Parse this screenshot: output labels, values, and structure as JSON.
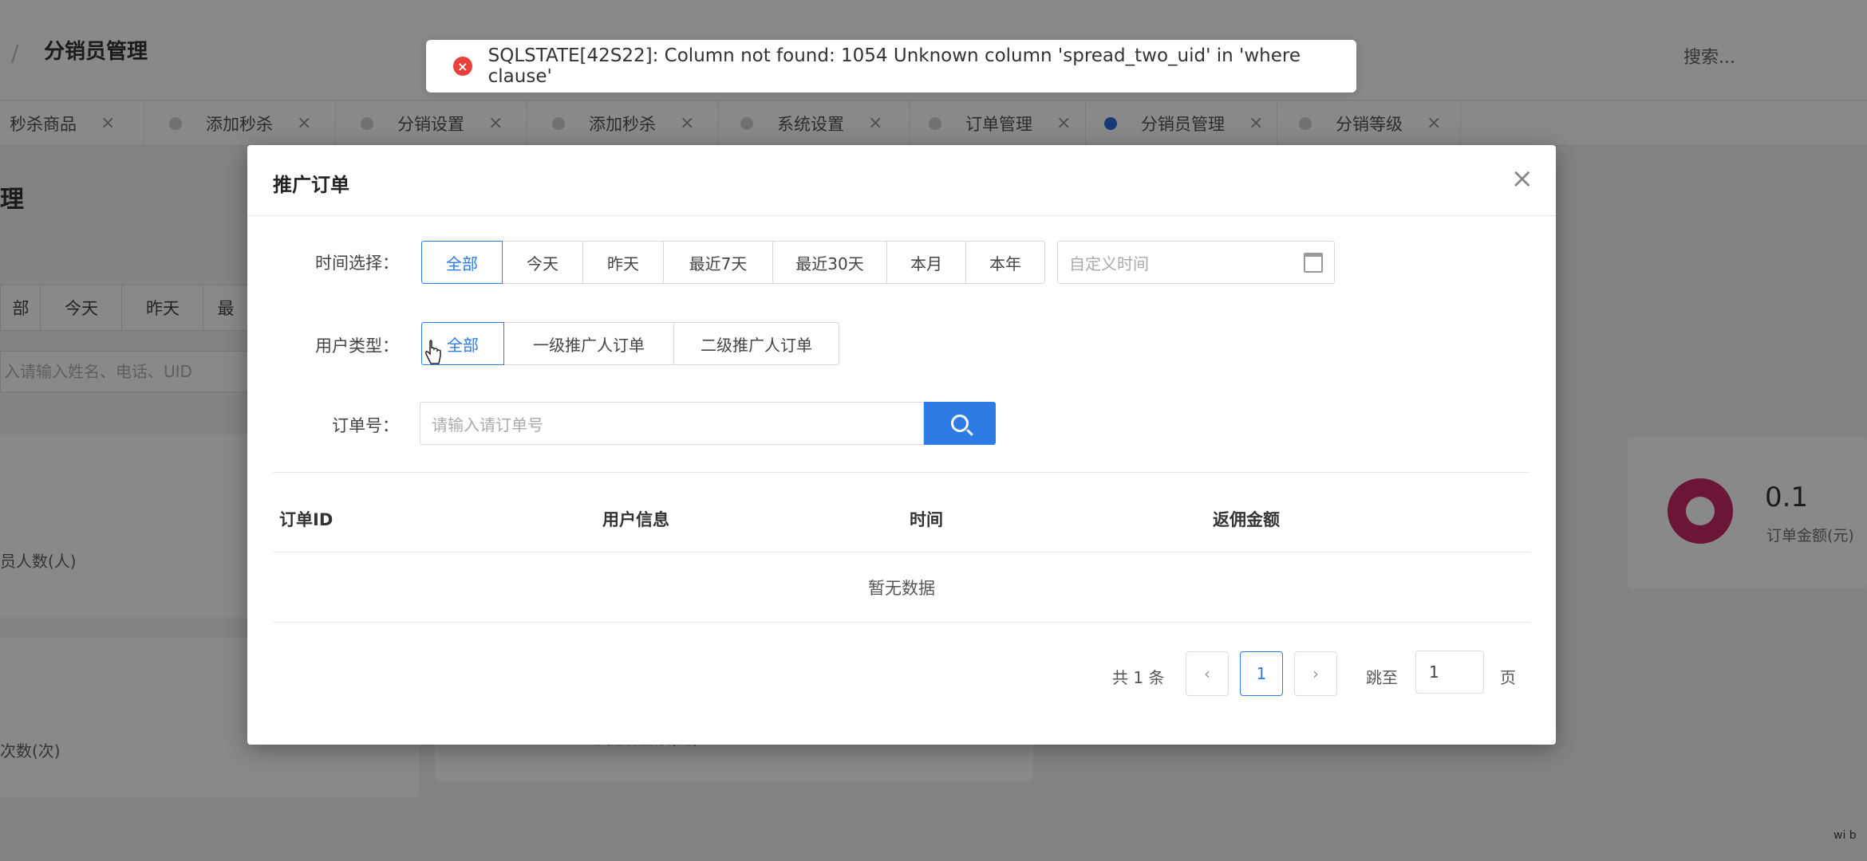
{
  "header": {
    "page_title": "分销员管理",
    "search_label": "搜索..."
  },
  "tabs": [
    {
      "label": "秒杀商品",
      "close": "×",
      "active": false
    },
    {
      "label": "添加秒杀",
      "close": "×",
      "active": false
    },
    {
      "label": "分销设置",
      "close": "×",
      "active": false
    },
    {
      "label": "添加秒杀",
      "close": "×",
      "active": false
    },
    {
      "label": "系统设置",
      "close": "×",
      "active": false
    },
    {
      "label": "订单管理",
      "close": "×",
      "active": false
    },
    {
      "label": "分销员管理",
      "close": "×",
      "active": true
    },
    {
      "label": "分销等级",
      "close": "×",
      "active": false
    }
  ],
  "toast": {
    "type": "error",
    "message": "SQLSTATE[42S22]: Column not found: 1054 Unknown column 'spread_two_uid' in 'where clause'"
  },
  "background": {
    "title_fragment": "理",
    "filters": [
      "部",
      "今天",
      "昨天",
      "最"
    ],
    "search_placeholder": "入请输入姓名、电话、UID",
    "card_label_1": "员人数(人)",
    "card_label_2": "次数(次)",
    "card_label_3": "未提现金额(元)",
    "stat_value": "0.1",
    "stat_label": "订单金额(元)"
  },
  "modal": {
    "title": "推广订单",
    "close": "×",
    "time_label": "时间选择：",
    "time_options": [
      "全部",
      "今天",
      "昨天",
      "最近7天",
      "最近30天",
      "本月",
      "本年"
    ],
    "time_selected": "全部",
    "date_placeholder": "自定义时间",
    "user_type_label": "用户类型：",
    "user_type_options": [
      "全部",
      "一级推广人订单",
      "二级推广人订单"
    ],
    "user_type_selected": "全部",
    "order_label": "订单号：",
    "order_placeholder": "请输入请订单号",
    "columns": [
      "订单ID",
      "用户信息",
      "时间",
      "返佣金额"
    ],
    "empty_text": "暂无数据",
    "pagination": {
      "total_text": "共 1 条",
      "prev": "‹",
      "current_page": "1",
      "next": "›",
      "jump_label": "跳至",
      "jump_value": "1",
      "page_label": "页"
    }
  },
  "watermark": "wi b",
  "colors": {
    "primary": "#2d7be5",
    "error": "#e8403b",
    "stat_icon": "#c2185b"
  }
}
